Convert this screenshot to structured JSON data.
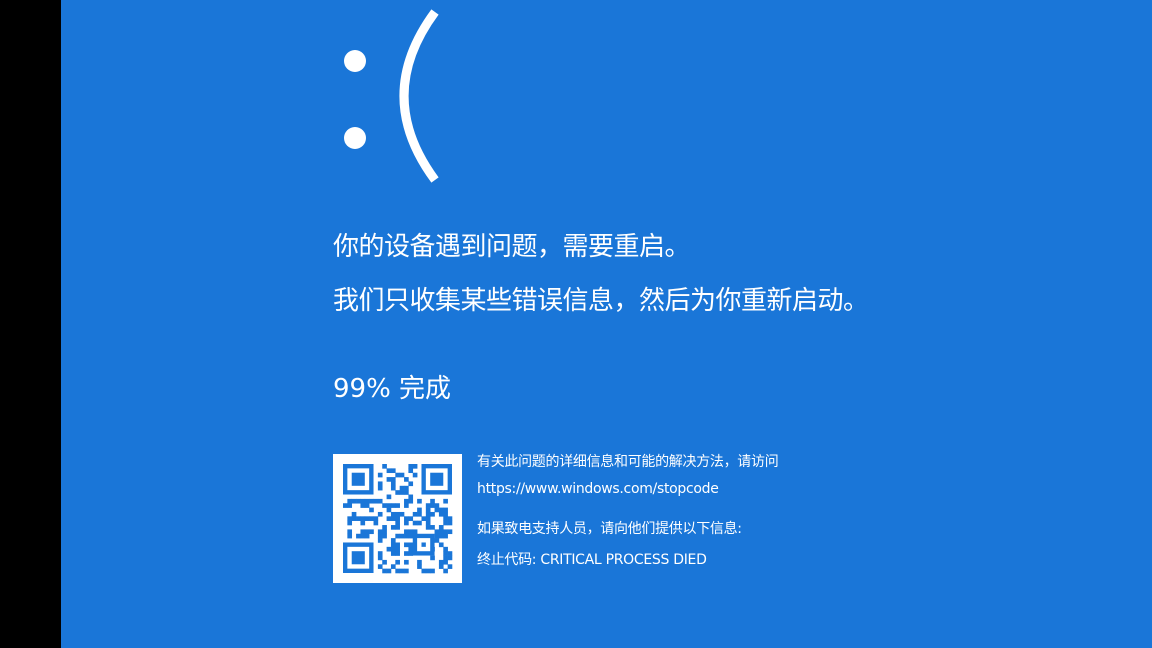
{
  "bsod": {
    "emoticon": ":(",
    "line1": "你的设备遇到问题，需要重启。",
    "line2": "我们只收集某些错误信息，然后为你重新启动。",
    "progress_percent": 99,
    "progress_text": "99% 完成",
    "info_line1": "有关此问题的详细信息和可能的解决方法，请访问",
    "url": "https://www.windows.com/stopcode",
    "support_line": "如果致电支持人员，请向他们提供以下信息:",
    "stop_code_line": "终止代码: CRITICAL PROCESS DIED"
  },
  "colors": {
    "background": "#1a76d8",
    "text": "#ffffff",
    "letterbox": "#000000"
  },
  "icons": {
    "qr": "qr-code-icon"
  }
}
